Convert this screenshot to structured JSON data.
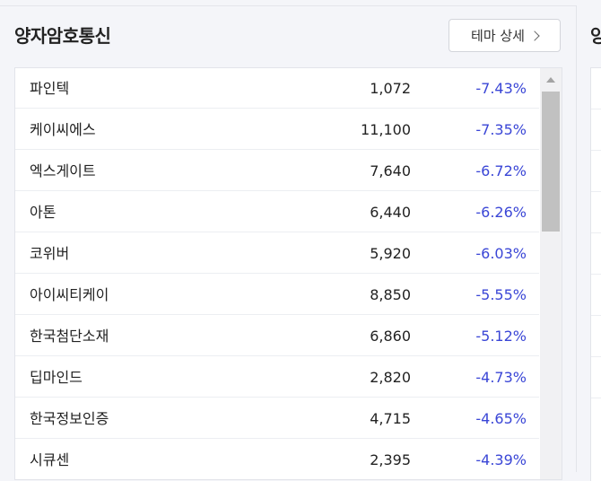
{
  "theme": {
    "title": "양자암호통신",
    "detail_button": "테마 상세",
    "stocks": [
      {
        "name": "파인텍",
        "price": "1,072",
        "change": "-7.43%"
      },
      {
        "name": "케이씨에스",
        "price": "11,100",
        "change": "-7.35%"
      },
      {
        "name": "엑스게이트",
        "price": "7,640",
        "change": "-6.72%"
      },
      {
        "name": "아톤",
        "price": "6,440",
        "change": "-6.26%"
      },
      {
        "name": "코위버",
        "price": "5,920",
        "change": "-6.03%"
      },
      {
        "name": "아이씨티케이",
        "price": "8,850",
        "change": "-5.55%"
      },
      {
        "name": "한국첨단소재",
        "price": "6,860",
        "change": "-5.12%"
      },
      {
        "name": "딥마인드",
        "price": "2,820",
        "change": "-4.73%"
      },
      {
        "name": "한국정보인증",
        "price": "4,715",
        "change": "-4.65%"
      },
      {
        "name": "시큐센",
        "price": "2,395",
        "change": "-4.39%"
      }
    ]
  },
  "next_panel": {
    "title": "양"
  },
  "colors": {
    "negative_change": "#3a46d6",
    "text": "#222222",
    "background": "#f4f5f9"
  },
  "icons": {
    "detail_chevron": "chevron-right-icon",
    "scroll_up": "arrow-up-icon"
  }
}
